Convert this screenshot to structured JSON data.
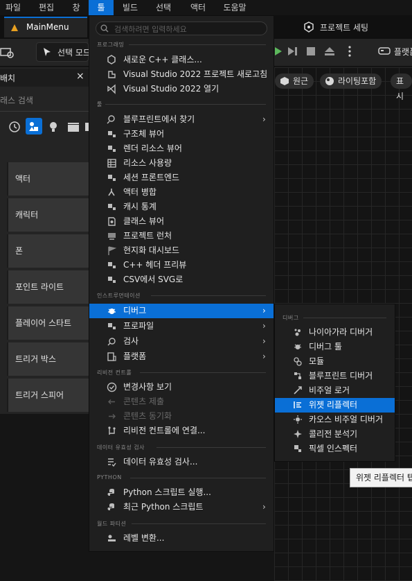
{
  "menubar": {
    "items": [
      {
        "label": "파일"
      },
      {
        "label": "편집"
      },
      {
        "label": "창"
      },
      {
        "label": "툴"
      },
      {
        "label": "빌드"
      },
      {
        "label": "선택"
      },
      {
        "label": "액터"
      },
      {
        "label": "도움말"
      }
    ]
  },
  "tabbar": {
    "main_tab": "MainMenu",
    "project_settings": "프로젝트 세팅"
  },
  "toolbar": {
    "select_mode": "선택 모드",
    "platform": "플랫폼"
  },
  "left_panel": {
    "title": "배치",
    "close": "×",
    "search_placeholder": "래스 검색",
    "categories": [
      {
        "label": "액터"
      },
      {
        "label": "캐릭터"
      },
      {
        "label": "폰"
      },
      {
        "label": "포인트 라이트"
      },
      {
        "label": "플레이어 스타트"
      },
      {
        "label": "트리거 박스"
      },
      {
        "label": "트리거 스피어"
      }
    ]
  },
  "viewport": {
    "perspective": "원근",
    "lighting": "라이팅포함",
    "show": "표시"
  },
  "menu": {
    "search_placeholder": "검색하려면 입력하세요",
    "sections": {
      "programming": "프로그래밍",
      "tools": "툴",
      "instrumentation": "인스트루먼테이션",
      "revision_control": "리비전 컨트롤",
      "data_validation": "데이터 유효성 검사",
      "python": "PYTHON",
      "world_partition": "월드 파티션"
    },
    "programming_items": [
      {
        "label": "새로운 C++ 클래스..."
      },
      {
        "label": "Visual Studio 2022 프로젝트 새로고침"
      },
      {
        "label": "Visual Studio 2022 열기"
      }
    ],
    "tools_items": [
      {
        "label": "블루프린트에서 찾기"
      },
      {
        "label": "구조체 뷰어"
      },
      {
        "label": "렌더 리소스 뷰어"
      },
      {
        "label": "리소스 사용량"
      },
      {
        "label": "세션 프론트엔드"
      },
      {
        "label": "액터 병합"
      },
      {
        "label": "캐시 통계"
      },
      {
        "label": "클래스 뷰어"
      },
      {
        "label": "프로젝트 런처"
      },
      {
        "label": "현지화 대시보드"
      },
      {
        "label": "C++ 헤더 프리뷰"
      },
      {
        "label": "CSV에서 SVG로"
      }
    ],
    "instrumentation_items": [
      {
        "label": "디버그"
      },
      {
        "label": "프로파일"
      },
      {
        "label": "검사"
      },
      {
        "label": "플랫폼"
      }
    ],
    "revision_items": [
      {
        "label": "변경사항 보기"
      },
      {
        "label": "콘텐츠 제출"
      },
      {
        "label": "콘텐츠 동기화"
      },
      {
        "label": "리비전 컨트롤에 연결..."
      }
    ],
    "validation_items": [
      {
        "label": "데이터 유효성 검사..."
      }
    ],
    "python_items": [
      {
        "label": "Python 스크립트 실행..."
      },
      {
        "label": "최근 Python 스크립트"
      }
    ],
    "world_items": [
      {
        "label": "레벨 변환..."
      }
    ],
    "arrow": "›"
  },
  "submenu": {
    "section": "디버그",
    "items": [
      {
        "label": "나이아가라 디버거"
      },
      {
        "label": "디버그 툴"
      },
      {
        "label": "모듈"
      },
      {
        "label": "블루프린트 디버거"
      },
      {
        "label": "비주얼 로거"
      },
      {
        "label": "위젯 리플렉터"
      },
      {
        "label": "카오스 비주얼 디버거"
      },
      {
        "label": "콜리전 분석기"
      },
      {
        "label": "픽셀 인스펙터"
      }
    ]
  },
  "tooltip": {
    "text": "위젯 리플렉터 탭"
  },
  "colors": {
    "accent": "#0a6fd6",
    "menu_bg": "#1f1f1f",
    "panel_bg": "#242424"
  }
}
